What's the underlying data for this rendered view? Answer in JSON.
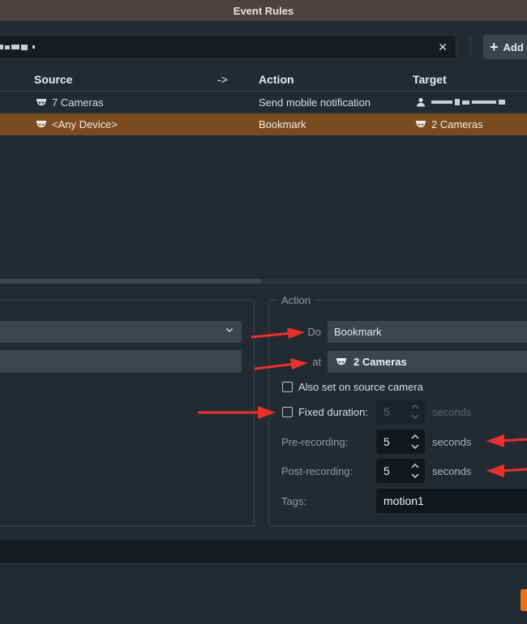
{
  "window": {
    "title": "Event Rules"
  },
  "toolbar": {
    "search_clear_icon": "close-icon",
    "add_label": "Add"
  },
  "table": {
    "columns": {
      "source": "Source",
      "arrow": "->",
      "action": "Action",
      "target": "Target"
    },
    "rows": [
      {
        "source": "7 Cameras",
        "action": "Send mobile notification",
        "target_icon": "user-icon",
        "selected": false
      },
      {
        "source": "<Any Device>",
        "action": "Bookmark",
        "target": "2 Cameras",
        "selected": true
      }
    ]
  },
  "action_panel": {
    "group_label": "Action",
    "do_label": "Do",
    "do_value": "Bookmark",
    "at_label": "at",
    "at_value": "2 Cameras",
    "also_set_label": "Also set on source camera",
    "also_set_checked": false,
    "fixed_duration_label": "Fixed duration:",
    "fixed_duration_checked": false,
    "fixed_duration_value": "5",
    "fixed_duration_unit": "seconds",
    "pre_recording_label": "Pre-recording:",
    "pre_recording_value": "5",
    "pre_recording_unit": "seconds",
    "post_recording_label": "Post-recording:",
    "post_recording_value": "5",
    "post_recording_unit": "seconds",
    "tags_label": "Tags:",
    "tags_value": "motion1"
  },
  "colors": {
    "selected_row": "#7a4b1f",
    "annotation_arrow": "#e8312a",
    "primary_button": "#e8731a"
  }
}
